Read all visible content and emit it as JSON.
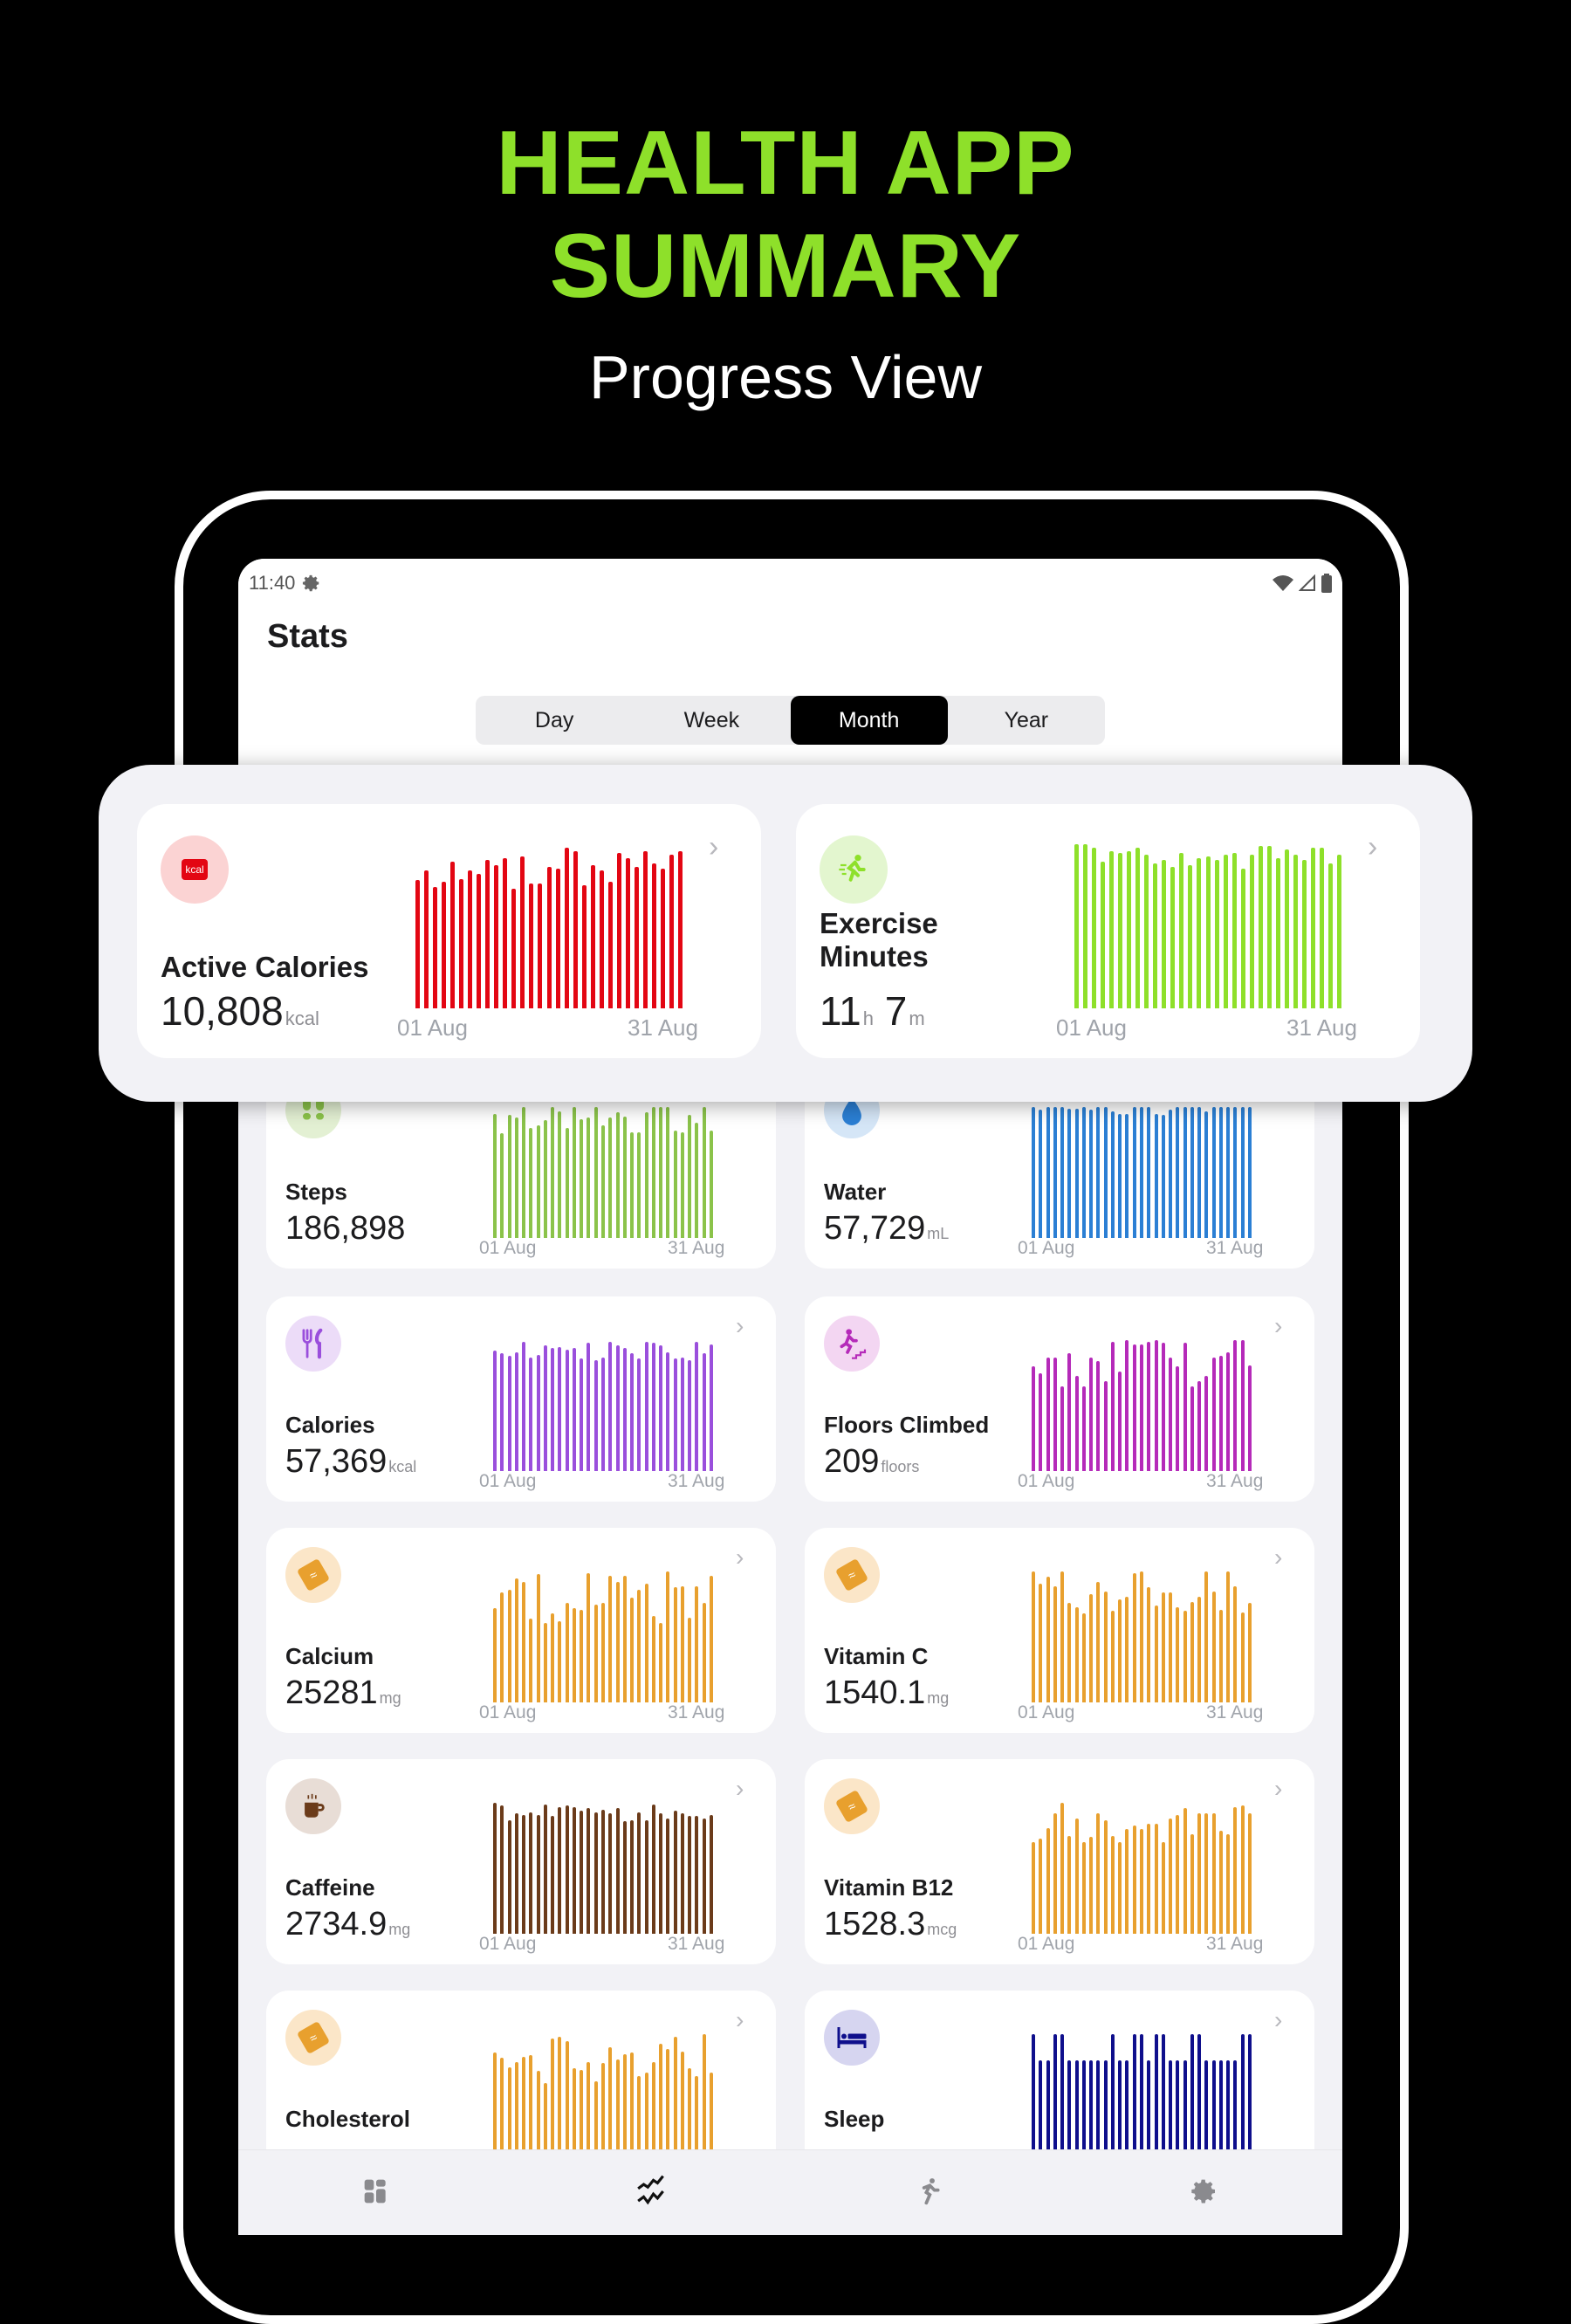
{
  "hero": {
    "title_line1": "HEALTH APP",
    "title_line2": "SUMMARY",
    "subtitle": "Progress View"
  },
  "status_bar": {
    "time": "11:40",
    "icons": [
      "gear-icon",
      "wifi-icon",
      "signal-icon",
      "battery-icon"
    ]
  },
  "page": {
    "title": "Stats"
  },
  "segments": [
    {
      "label": "Day",
      "active": false
    },
    {
      "label": "Week",
      "active": false
    },
    {
      "label": "Month",
      "active": true
    },
    {
      "label": "Year",
      "active": false
    }
  ],
  "axis": {
    "start": "01 Aug",
    "end": "31 Aug"
  },
  "highlighted_cards": [
    {
      "id": "active-calories",
      "label": "Active Calories",
      "value": "10,808",
      "unit": "kcal",
      "icon": "kcal-icon",
      "icon_text": "kcal",
      "color": "#e30613",
      "icon_bg": "#fbd3d3",
      "bars": [
        0.74,
        0.8,
        0.7,
        0.73,
        0.85,
        0.75,
        0.8,
        0.78,
        0.86,
        0.83,
        0.87,
        0.69,
        0.88,
        0.72,
        0.72,
        0.82,
        0.81,
        0.93,
        0.91,
        0.71,
        0.83,
        0.8,
        0.73,
        0.9,
        0.87,
        0.82,
        0.91,
        0.84,
        0.81,
        0.89,
        0.91
      ]
    },
    {
      "id": "exercise-minutes",
      "label": "Exercise Minutes",
      "value_h": "11",
      "unit_h": "h",
      "value_m": "7",
      "unit_m": "m",
      "icon": "running-icon",
      "color": "#8ee02a",
      "icon_bg": "#e3f6cf",
      "bars": [
        0.95,
        0.95,
        0.93,
        0.85,
        0.91,
        0.9,
        0.91,
        0.93,
        0.89,
        0.84,
        0.86,
        0.82,
        0.9,
        0.83,
        0.87,
        0.88,
        0.86,
        0.89,
        0.9,
        0.81,
        0.89,
        0.94,
        0.94,
        0.87,
        0.92,
        0.89,
        0.86,
        0.93,
        0.93,
        0.84,
        0.89
      ]
    }
  ],
  "cards": [
    {
      "id": "steps",
      "label": "Steps",
      "value": "186,898",
      "unit": "",
      "icon": "footprints-icon",
      "color": "#8bc34a",
      "icon_bg": "#e3f0d3",
      "bars": [
        0.95,
        0.8,
        0.94,
        0.92,
        1.0,
        0.84,
        0.86,
        0.9,
        1.0,
        0.97,
        0.84,
        1.0,
        0.91,
        0.92,
        1.0,
        0.86,
        0.92,
        0.96,
        0.93,
        0.81,
        0.81,
        0.96,
        1.0,
        1.0,
        1.0,
        0.82,
        0.81,
        0.94,
        0.88,
        1.0,
        0.82
      ]
    },
    {
      "id": "water",
      "label": "Water",
      "value": "57,729",
      "unit": "mL",
      "icon": "water-drop-icon",
      "color": "#2b7fd4",
      "icon_bg": "#d5e6f7",
      "bars": [
        1.0,
        0.98,
        1.0,
        1.0,
        1.0,
        0.99,
        0.99,
        1.0,
        0.98,
        1.0,
        1.0,
        0.97,
        0.95,
        0.95,
        1.0,
        1.0,
        1.0,
        0.95,
        0.94,
        0.98,
        1.0,
        1.0,
        1.0,
        1.0,
        0.97,
        1.0,
        1.0,
        1.0,
        1.0,
        1.0,
        1.0
      ]
    },
    {
      "id": "calories",
      "label": "Calories",
      "value": "57,369",
      "unit": "kcal",
      "icon": "fork-knife-icon",
      "color": "#9a4fdc",
      "icon_bg": "#ecdcf8",
      "bars": [
        0.92,
        0.9,
        0.88,
        0.91,
        0.99,
        0.87,
        0.89,
        0.96,
        0.94,
        0.95,
        0.93,
        0.94,
        0.86,
        0.98,
        0.85,
        0.87,
        0.99,
        0.96,
        0.94,
        0.9,
        0.86,
        0.99,
        0.98,
        0.96,
        0.91,
        0.86,
        0.87,
        0.85,
        0.99,
        0.9,
        0.97
      ]
    },
    {
      "id": "floors-climbed",
      "label": "Floors Climbed",
      "value": "209",
      "unit": "floors",
      "icon": "stairs-icon",
      "color": "#b52ab9",
      "icon_bg": "#f3d6f2",
      "bars": [
        0.8,
        0.75,
        0.87,
        0.87,
        0.65,
        0.9,
        0.73,
        0.65,
        0.87,
        0.84,
        0.69,
        0.99,
        0.76,
        1.0,
        0.97,
        0.97,
        0.99,
        1.0,
        0.98,
        0.87,
        0.8,
        0.98,
        0.65,
        0.69,
        0.73,
        0.87,
        0.88,
        0.91,
        1.0,
        1.0,
        0.81
      ]
    },
    {
      "id": "calcium",
      "label": "Calcium",
      "value": "25281",
      "unit": "mg",
      "icon": "pill-icon",
      "color": "#e8a02e",
      "icon_bg": "#fbe6c8",
      "bars": [
        0.72,
        0.84,
        0.86,
        0.95,
        0.92,
        0.64,
        0.98,
        0.61,
        0.68,
        0.62,
        0.76,
        0.72,
        0.71,
        0.99,
        0.75,
        0.76,
        0.97,
        0.92,
        0.97,
        0.8,
        0.86,
        0.91,
        0.66,
        0.61,
        1.0,
        0.88,
        0.89,
        0.65,
        0.89,
        0.76,
        0.97
      ]
    },
    {
      "id": "vitamin-c",
      "label": "Vitamin C",
      "value": "1540.1",
      "unit": "mg",
      "icon": "pill-icon",
      "color": "#e8a02e",
      "icon_bg": "#fbe6c8",
      "bars": [
        1.0,
        0.91,
        0.96,
        0.89,
        1.0,
        0.76,
        0.73,
        0.68,
        0.83,
        0.92,
        0.85,
        0.7,
        0.79,
        0.81,
        0.99,
        1.0,
        0.88,
        0.74,
        0.84,
        0.84,
        0.73,
        0.7,
        0.77,
        0.81,
        1.0,
        0.85,
        0.71,
        1.0,
        0.89,
        0.69,
        0.76
      ]
    },
    {
      "id": "caffeine",
      "label": "Caffeine",
      "value": "2734.9",
      "unit": "mg",
      "icon": "coffee-cup-icon",
      "color": "#6b3b1a",
      "icon_bg": "#e8ddd6",
      "bars": [
        1.0,
        0.98,
        0.87,
        0.92,
        0.91,
        0.93,
        0.91,
        0.99,
        0.9,
        0.97,
        0.98,
        0.97,
        0.94,
        0.96,
        0.93,
        0.95,
        0.92,
        0.96,
        0.86,
        0.87,
        0.93,
        0.87,
        0.99,
        0.92,
        0.88,
        0.94,
        0.92,
        0.9,
        0.9,
        0.88,
        0.91
      ]
    },
    {
      "id": "vitamin-b12",
      "label": "Vitamin B12",
      "value": "1528.3",
      "unit": "mcg",
      "icon": "pill-icon",
      "color": "#e8a02e",
      "icon_bg": "#fbe6c8",
      "bars": [
        0.7,
        0.73,
        0.81,
        0.92,
        1.0,
        0.75,
        0.88,
        0.7,
        0.74,
        0.92,
        0.87,
        0.75,
        0.7,
        0.8,
        0.83,
        0.8,
        0.84,
        0.84,
        0.7,
        0.88,
        0.91,
        0.96,
        0.76,
        0.92,
        0.92,
        0.92,
        0.79,
        0.76,
        0.97,
        0.98,
        0.92
      ]
    },
    {
      "id": "cholesterol",
      "label": "Cholesterol",
      "value": "",
      "unit": "",
      "icon": "pill-icon",
      "color": "#e8a02e",
      "icon_bg": "#fbe6c8",
      "bars": [
        0.86,
        0.82,
        0.75,
        0.79,
        0.83,
        0.84,
        0.72,
        0.63,
        0.97,
        0.98,
        0.95,
        0.74,
        0.73,
        0.79,
        0.64,
        0.78,
        0.9,
        0.81,
        0.85,
        0.86,
        0.68,
        0.71,
        0.79,
        0.93,
        0.89,
        0.98,
        0.87,
        0.74,
        0.68,
        1.0,
        0.71
      ]
    },
    {
      "id": "sleep",
      "label": "Sleep",
      "value": "",
      "unit": "",
      "icon": "bed-icon",
      "color": "#0f0f8c",
      "icon_bg": "#d6d5f0",
      "bars": [
        1,
        0.8,
        0.8,
        1,
        1,
        0.8,
        0.8,
        0.8,
        0.8,
        0.8,
        0.8,
        1,
        0.8,
        0.8,
        1,
        1,
        0.8,
        1,
        1,
        0.8,
        0.8,
        0.8,
        1,
        1,
        0.8,
        0.8,
        0.8,
        0.8,
        0.8,
        1,
        1
      ]
    }
  ],
  "bottom_nav": [
    {
      "name": "nav-dashboard",
      "icon": "dashboard-icon",
      "active": false
    },
    {
      "name": "nav-stats",
      "icon": "trend-chart-icon",
      "active": true
    },
    {
      "name": "nav-activity",
      "icon": "running-icon",
      "active": false
    },
    {
      "name": "nav-settings",
      "icon": "gear-icon",
      "active": false
    }
  ]
}
